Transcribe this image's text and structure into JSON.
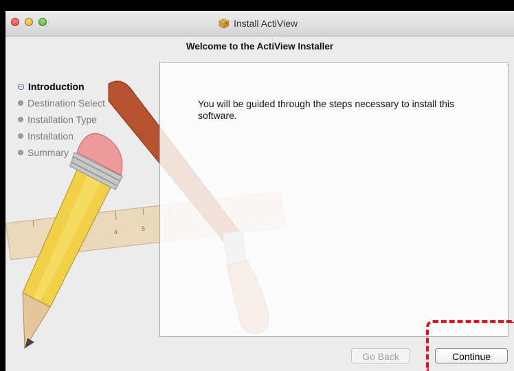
{
  "window": {
    "title": "Install ActiView",
    "title_icon": "package-icon"
  },
  "main": {
    "heading": "Welcome to the ActiView Installer",
    "body_text": "You will be guided through the steps necessary to install this software."
  },
  "sidebar": {
    "steps": [
      {
        "label": "Introduction",
        "active": true
      },
      {
        "label": "Destination Select",
        "active": false
      },
      {
        "label": "Installation Type",
        "active": false
      },
      {
        "label": "Installation",
        "active": false
      },
      {
        "label": "Summary",
        "active": false
      }
    ]
  },
  "buttons": {
    "go_back": "Go Back",
    "continue": "Continue"
  },
  "ruler_numbers": [
    "4",
    "5",
    "9",
    "10"
  ],
  "colors": {
    "annotation_highlight": "#e0131b",
    "active_step_bullet": "#2c63c9"
  }
}
